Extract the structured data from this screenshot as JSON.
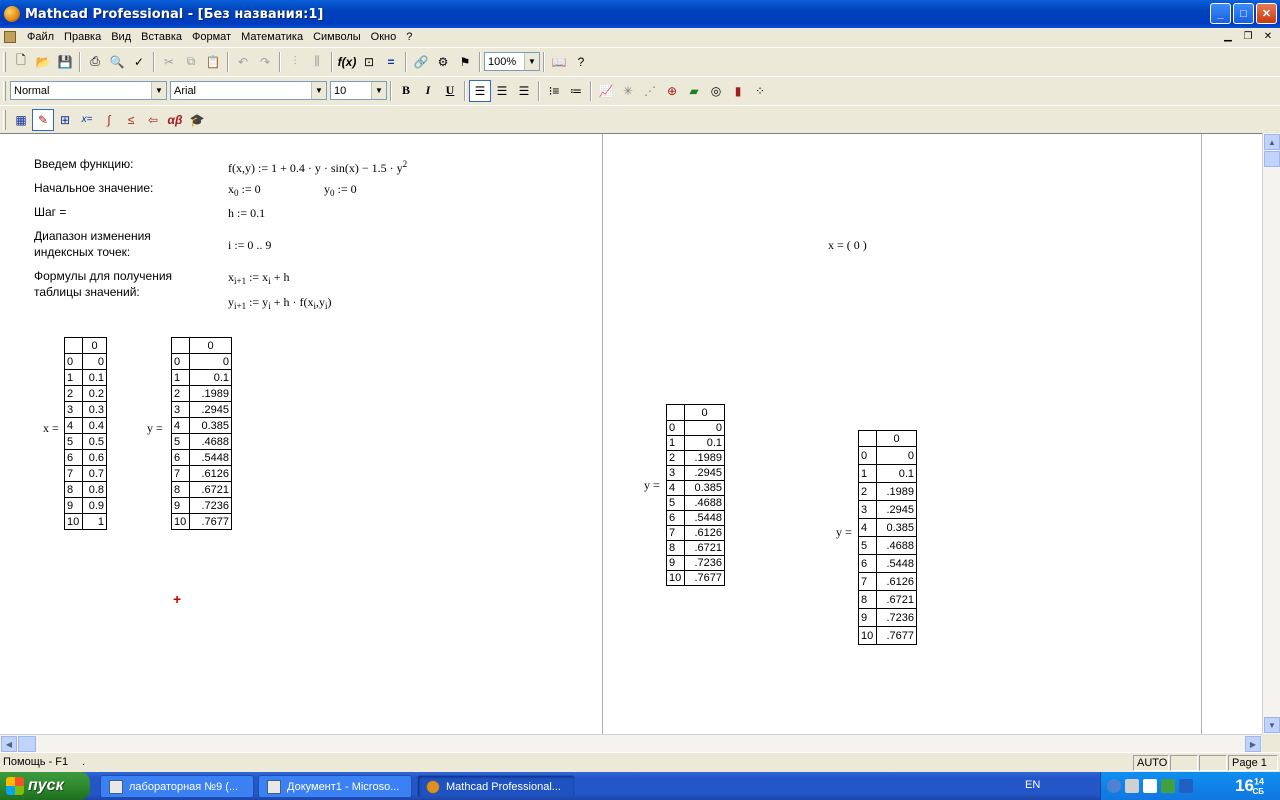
{
  "window": {
    "title": "Mathcad Professional - [Без названия:1]",
    "min": "_",
    "max": "□",
    "close": "✕"
  },
  "menu": [
    "Файл",
    "Правка",
    "Вид",
    "Вставка",
    "Формат",
    "Математика",
    "Символы",
    "Окно",
    "?"
  ],
  "toolbar_format": {
    "style": "Normal",
    "font": "Arial",
    "size": "10",
    "zoom": "100%"
  },
  "sheet": {
    "labels": {
      "func": "Введем функцию:",
      "init": "Начальное значение:",
      "step": "Шаг =",
      "range1": "Диапазон изменения",
      "range2": "индексных точек:",
      "formulas1": "Формулы для получения",
      "formulas2": "таблицы значений:"
    },
    "eq_func_left": "f(x,y) := 1 + 0.4 · y · sin(x) − 1.5 · y",
    "eq_func_exp": "2",
    "x0_name": "x",
    "x0_sub": "0",
    "x0_rhs": " := 0",
    "y0_name": "y",
    "y0_sub": "0",
    "y0_rhs": " := 0",
    "h_eq": "h := 0.1",
    "i_eq": "i := 0 .. 9",
    "x_rec": {
      "a": "x",
      "as": "i+1",
      "b": " := x",
      "bs": "i",
      "c": " + h"
    },
    "y_rec": {
      "a": "y",
      "as": "i+1",
      "b": " := y",
      "bs": "i",
      "c": " + h · f(x",
      "cs": "i",
      "d": ",y",
      "ds": "i",
      "e": ")"
    },
    "x_eq_right": "x = ( 0 )",
    "x_label": "x =",
    "y_label": "y ="
  },
  "x_table": {
    "header": "0",
    "rows": [
      [
        "0",
        "0"
      ],
      [
        "1",
        "0.1"
      ],
      [
        "2",
        "0.2"
      ],
      [
        "3",
        "0.3"
      ],
      [
        "4",
        "0.4"
      ],
      [
        "5",
        "0.5"
      ],
      [
        "6",
        "0.6"
      ],
      [
        "7",
        "0.7"
      ],
      [
        "8",
        "0.8"
      ],
      [
        "9",
        "0.9"
      ],
      [
        "10",
        "1"
      ]
    ]
  },
  "y_table": {
    "header": "0",
    "rows": [
      [
        "0",
        "0"
      ],
      [
        "1",
        "0.1"
      ],
      [
        "2",
        ".1989"
      ],
      [
        "3",
        ".2945"
      ],
      [
        "4",
        "0.385"
      ],
      [
        "5",
        ".4688"
      ],
      [
        "6",
        ".5448"
      ],
      [
        "7",
        ".6126"
      ],
      [
        "8",
        ".6721"
      ],
      [
        "9",
        ".7236"
      ],
      [
        "10",
        ".7677"
      ]
    ]
  },
  "status": {
    "help": "Помощь - F1",
    "dot": ".",
    "mode": "AUTO",
    "page": "Page 1"
  },
  "taskbar": {
    "start": "пуск",
    "tasks": [
      "лабораторная №9 (...",
      "Документ1 - Microso...",
      "Mathcad Professional..."
    ],
    "lang": "EN",
    "clock_h": "16",
    "clock_m": "14",
    "clock_s": "СБ"
  }
}
